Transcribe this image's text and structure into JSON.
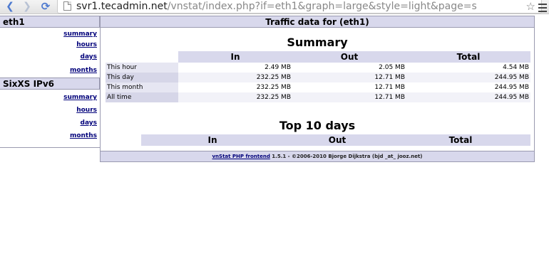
{
  "browser": {
    "url_host": "svr1.tecadmin.net",
    "url_path": "/vnstat/index.php?if=eth1&graph=large&style=light&page=s"
  },
  "sidebar": {
    "interfaces": [
      {
        "name": "eth1",
        "links": [
          "summary",
          "hours",
          "days",
          "months"
        ]
      },
      {
        "name": "SixXS IPv6",
        "links": [
          "summary",
          "hours",
          "days",
          "months"
        ]
      }
    ]
  },
  "main": {
    "title": "Traffic data for (eth1)",
    "summary": {
      "heading": "Summary",
      "columns": [
        "In",
        "Out",
        "Total"
      ],
      "rows": [
        {
          "label": "This hour",
          "in": "2.49 MB",
          "out": "2.05 MB",
          "total": "4.54 MB"
        },
        {
          "label": "This day",
          "in": "232.25 MB",
          "out": "12.71 MB",
          "total": "244.95 MB"
        },
        {
          "label": "This month",
          "in": "232.25 MB",
          "out": "12.71 MB",
          "total": "244.95 MB"
        },
        {
          "label": "All time",
          "in": "232.25 MB",
          "out": "12.71 MB",
          "total": "244.95 MB"
        }
      ]
    },
    "top10": {
      "heading": "Top 10 days",
      "columns": [
        "In",
        "Out",
        "Total"
      ]
    }
  },
  "footer": {
    "link_text": "vnStat PHP frontend",
    "credit": " 1.5.1 - ©2006-2010 Bjorge Dijkstra (bjd _at_ jooz.net)"
  }
}
